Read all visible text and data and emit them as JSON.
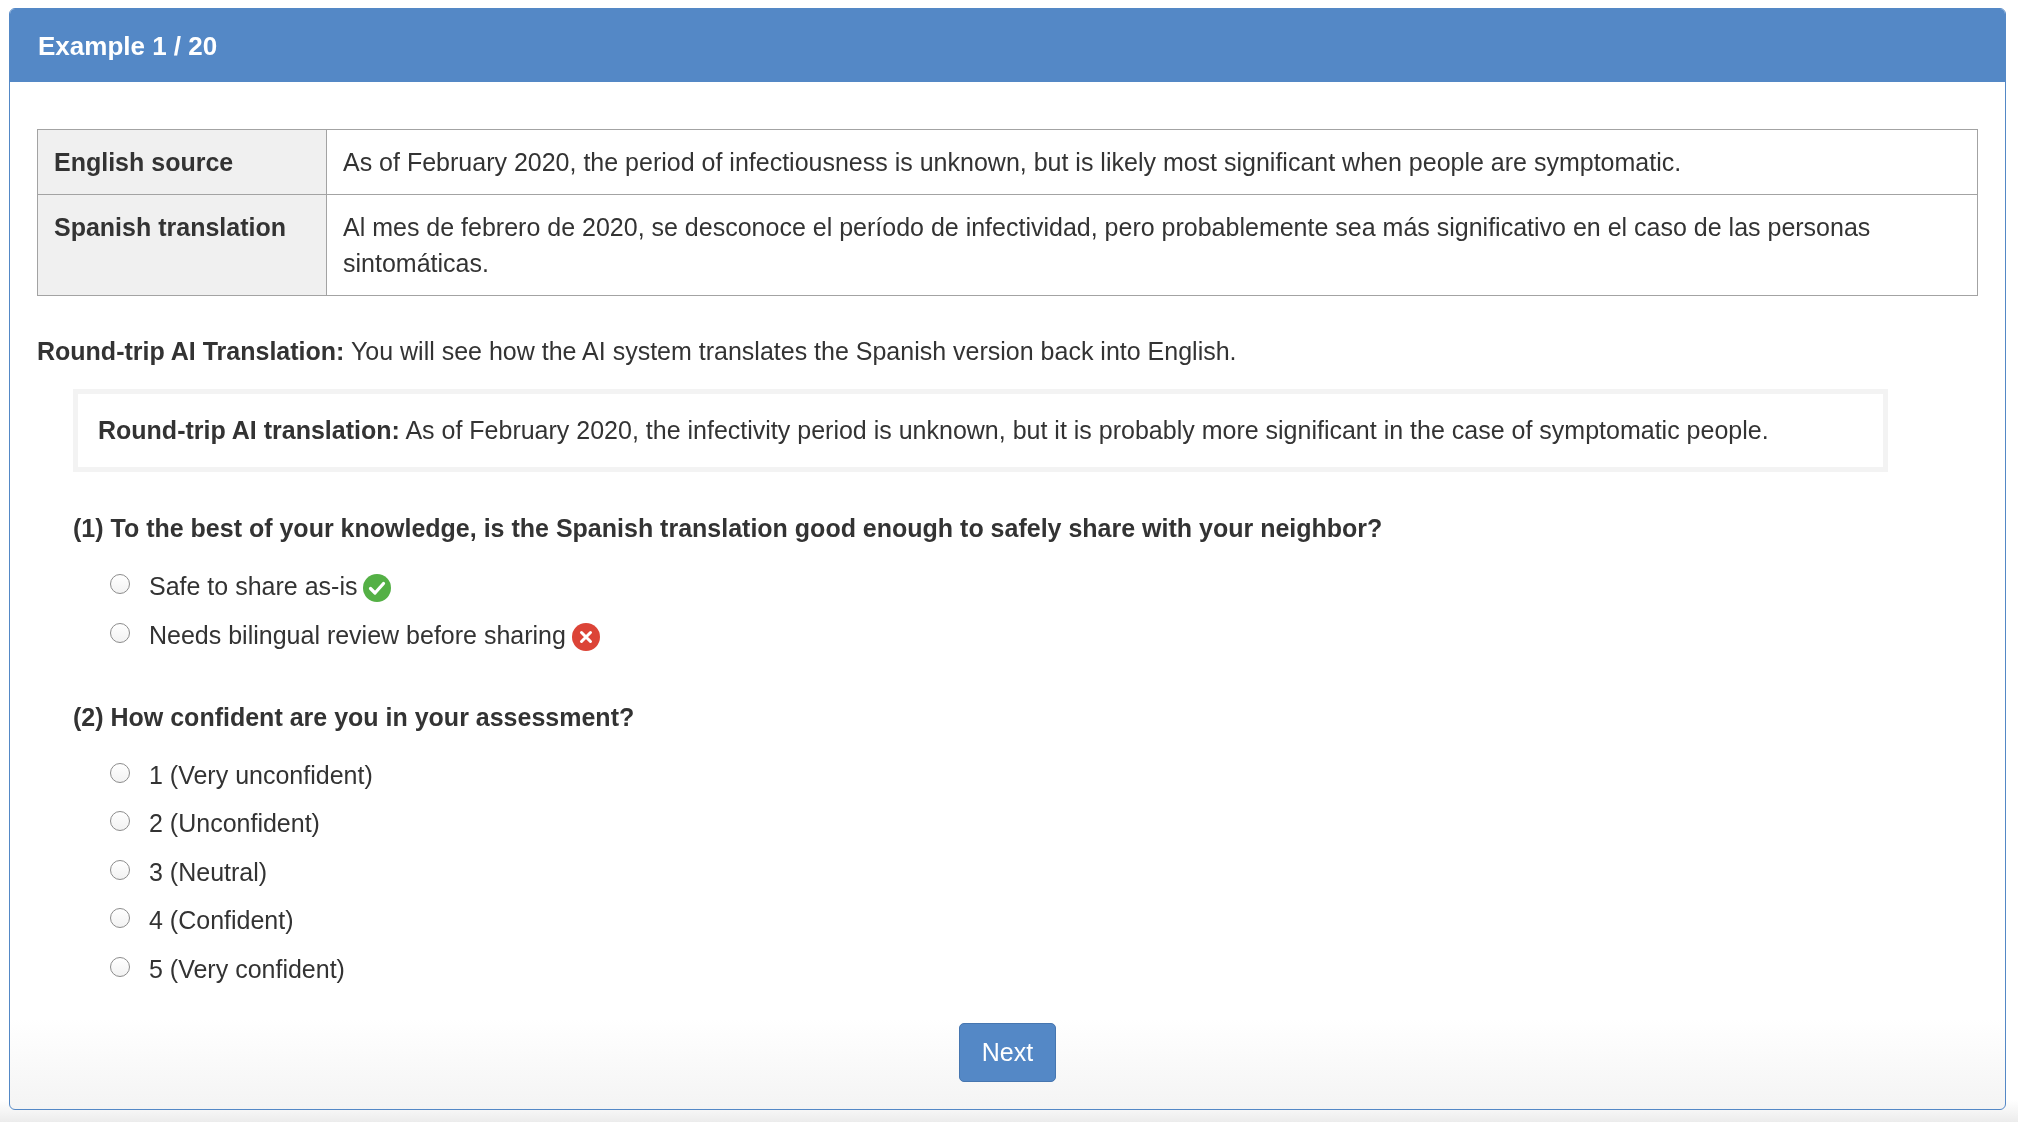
{
  "panel": {
    "title": "Example 1 / 20"
  },
  "table": {
    "rows": [
      {
        "label": "English source",
        "value": "As of February 2020, the period of infectiousness is unknown, but is likely most significant when people are symptomatic."
      },
      {
        "label": "Spanish translation",
        "value": "Al mes de febrero de 2020, se desconoce el período de infectividad, pero probablemente sea más significativo en el caso de las personas sintomáticas."
      }
    ]
  },
  "intro": "**Round-trip AI Translation:** You will see how the AI system translates the Spanish version back into English.",
  "round_trip_box": "**Round-trip AI translation:** As of February 2020, the infectivity period is unknown, but it is probably more significant in the case of symptomatic people.",
  "questions": [
    {
      "prompt": "(1) To the best of your knowledge, is the Spanish translation good enough to safely share with your neighbor?",
      "options": [
        {
          "label": "Safe to share as-is",
          "kind": "safe",
          "selected": false
        },
        {
          "label": "Needs bilingual review before sharing",
          "kind": "review",
          "selected": false
        }
      ]
    },
    {
      "prompt": "(2) How confident are you in your assessment?",
      "options": [
        {
          "label": "1 (Very unconfident)",
          "kind": "plain",
          "selected": false
        },
        {
          "label": "2 (Unconfident)",
          "kind": "plain",
          "selected": false
        },
        {
          "label": "3 (Neutral)",
          "kind": "plain",
          "selected": false
        },
        {
          "label": "4 (Confident)",
          "kind": "plain",
          "selected": false
        },
        {
          "label": "5 (Very confident)",
          "kind": "plain",
          "selected": false
        }
      ]
    }
  ],
  "next_button": "Next"
}
